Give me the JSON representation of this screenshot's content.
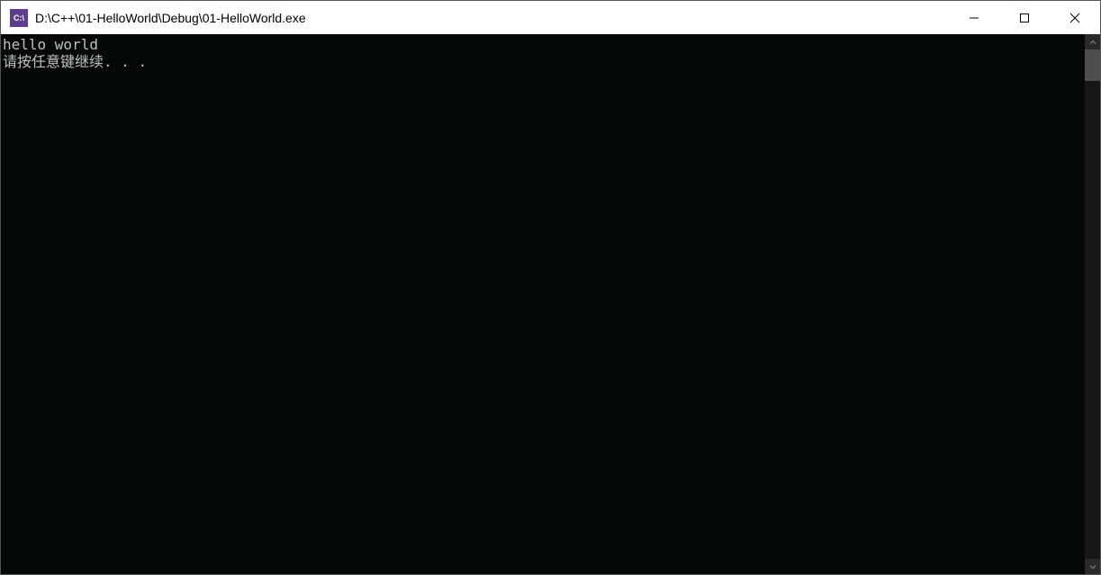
{
  "window": {
    "icon_text": "C:\\",
    "title": "D:\\C++\\01-HelloWorld\\Debug\\01-HelloWorld.exe"
  },
  "terminal": {
    "lines": [
      "hello world",
      "请按任意键继续. . ."
    ]
  },
  "colors": {
    "terminal_bg": "#060808",
    "terminal_fg": "#c0c0c0",
    "titlebar_bg": "#ffffff",
    "icon_bg": "#5d3e8e"
  }
}
